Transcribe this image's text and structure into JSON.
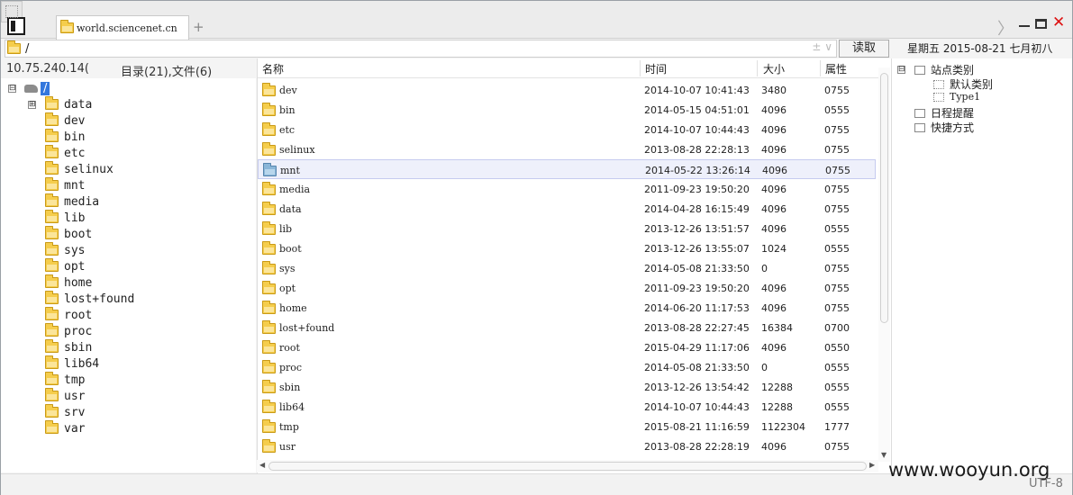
{
  "tabs": {
    "active_title": "world.sciencenet.cn",
    "add_label": "+",
    "next_label": "〉",
    "close_label": "✕"
  },
  "address": {
    "path": "/",
    "options_label": "± ∨",
    "read_button": "读取"
  },
  "date_label": "星期五 2015-08-21 七月初八",
  "status": {
    "host": "10.75.240.14(",
    "dir_count": "目录(21),文件(6)"
  },
  "tree": {
    "root": "/",
    "expand_symbol": "⊞",
    "collapse_symbol": "⊟",
    "items": [
      "data",
      "dev",
      "bin",
      "etc",
      "selinux",
      "mnt",
      "media",
      "lib",
      "boot",
      "sys",
      "opt",
      "home",
      "lost+found",
      "root",
      "proc",
      "sbin",
      "lib64",
      "tmp",
      "usr",
      "srv",
      "var"
    ]
  },
  "columns": {
    "name": "名称",
    "time": "时间",
    "size": "大小",
    "attr": "属性"
  },
  "files": [
    {
      "name": "dev",
      "time": "2014-10-07 10:41:43",
      "size": "3480",
      "attr": "0755"
    },
    {
      "name": "bin",
      "time": "2014-05-15 04:51:01",
      "size": "4096",
      "attr": "0555"
    },
    {
      "name": "etc",
      "time": "2014-10-07 10:44:43",
      "size": "4096",
      "attr": "0755"
    },
    {
      "name": "selinux",
      "time": "2013-08-28 22:28:13",
      "size": "4096",
      "attr": "0755"
    },
    {
      "name": "mnt",
      "time": "2014-05-22 13:26:14",
      "size": "4096",
      "attr": "0755",
      "selected": true
    },
    {
      "name": "media",
      "time": "2011-09-23 19:50:20",
      "size": "4096",
      "attr": "0755"
    },
    {
      "name": "data",
      "time": "2014-04-28 16:15:49",
      "size": "4096",
      "attr": "0755"
    },
    {
      "name": "lib",
      "time": "2013-12-26 13:51:57",
      "size": "4096",
      "attr": "0555"
    },
    {
      "name": "boot",
      "time": "2013-12-26 13:55:07",
      "size": "1024",
      "attr": "0555"
    },
    {
      "name": "sys",
      "time": "2014-05-08 21:33:50",
      "size": "0",
      "attr": "0755"
    },
    {
      "name": "opt",
      "time": "2011-09-23 19:50:20",
      "size": "4096",
      "attr": "0755"
    },
    {
      "name": "home",
      "time": "2014-06-20 11:17:53",
      "size": "4096",
      "attr": "0755"
    },
    {
      "name": "lost+found",
      "time": "2013-08-28 22:27:45",
      "size": "16384",
      "attr": "0700"
    },
    {
      "name": "root",
      "time": "2015-04-29 11:17:06",
      "size": "4096",
      "attr": "0550"
    },
    {
      "name": "proc",
      "time": "2014-05-08 21:33:50",
      "size": "0",
      "attr": "0555"
    },
    {
      "name": "sbin",
      "time": "2013-12-26 13:54:42",
      "size": "12288",
      "attr": "0555"
    },
    {
      "name": "lib64",
      "time": "2014-10-07 10:44:43",
      "size": "12288",
      "attr": "0555"
    },
    {
      "name": "tmp",
      "time": "2015-08-21 11:16:59",
      "size": "1122304",
      "attr": "1777"
    },
    {
      "name": "usr",
      "time": "2013-08-28 22:28:19",
      "size": "4096",
      "attr": "0755"
    }
  ],
  "side": {
    "categories": "站点类别",
    "default_category": "默认类别",
    "type1": "Type1",
    "schedule": "日程提醒",
    "shortcuts": "快捷方式"
  },
  "footer": {
    "watermark": "www.wooyun.org",
    "encoding": "UTF-8"
  },
  "colors": {
    "folder": "#f5cd4c",
    "selected_folder": "#8ab6d8",
    "tree_selection": "#3377dd",
    "close_button": "#dd1111"
  },
  "icons": [
    "panel-toggle-icon",
    "folder-icon",
    "drive-icon",
    "expand-icon",
    "close-icon",
    "minimize-icon",
    "maximize-icon",
    "chevron-right-icon"
  ]
}
